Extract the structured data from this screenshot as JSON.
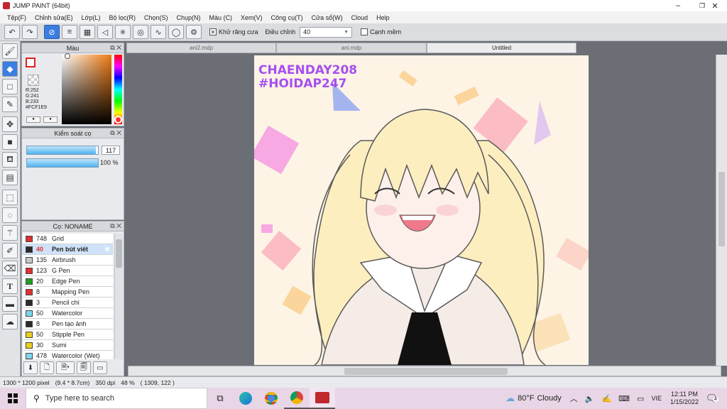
{
  "window": {
    "title": "JUMP PAINT (64bit)",
    "minimize": "–",
    "restore": "❐",
    "close": "✕"
  },
  "menu": [
    "Tệp(F)",
    "Chỉnh sửa(E)",
    "Lớp(L)",
    "Bộ lọc(R)",
    "Chọn(S)",
    "Chụp(N)",
    "Màu (C)",
    "Xem(V)",
    "Công cụ(T)",
    "Cửa sổ(W)",
    "Cloud",
    "Help"
  ],
  "toolbar": {
    "antialias_label": "Khử răng cưa",
    "correction_label": "Điều chỉnh",
    "correction_value": "40",
    "snap_label": "Cạnh mềm"
  },
  "color_panel": {
    "title": "Màu",
    "r": "R:252",
    "g": "G:241",
    "b": "B:233",
    "hex": "#FCF1E9"
  },
  "brush_control": {
    "title": "Kiểm soát cọ",
    "size_value": "117",
    "opacity_value": "100 %",
    "size_fraction": 0.97,
    "opacity_fraction": 1.0
  },
  "brush_panel": {
    "title": "Cọ: NONAME",
    "items": [
      {
        "size": "748",
        "name": "Grid",
        "color": "#e03030"
      },
      {
        "size": "40",
        "name": "Pen bút viết",
        "color": "#2a2a2a",
        "selected": true
      },
      {
        "size": "135",
        "name": "Airbrush",
        "color": "#c8c8c8"
      },
      {
        "size": "123",
        "name": "G Pen",
        "color": "#e03030"
      },
      {
        "size": "20",
        "name": "Edge Pen",
        "color": "#20a020"
      },
      {
        "size": "8",
        "name": "Mapping Pen",
        "color": "#e03030"
      },
      {
        "size": "3",
        "name": "Pencil chì",
        "color": "#2a2a2a"
      },
      {
        "size": "50",
        "name": "Watercolor",
        "color": "#7fd7f0"
      },
      {
        "size": "8",
        "name": "Pen tạo ảnh",
        "color": "#2a2a2a"
      },
      {
        "size": "50",
        "name": "Stipple Pen",
        "color": "#e8d020"
      },
      {
        "size": "30",
        "name": "Sumi",
        "color": "#e8d020"
      },
      {
        "size": "478",
        "name": "Watercolor (Wet)",
        "color": "#7fd7f0"
      }
    ]
  },
  "tabs": [
    "ani2.mdp",
    "ani.mdp",
    "Untitled"
  ],
  "canvas": {
    "text_line1": "CHAENDAY208",
    "text_line2": "#HOIDAP247",
    "bg_color": "#fdf4e6"
  },
  "status": {
    "dimensions": "1300 * 1200 pixel",
    "size_cm": "(9.4 * 8.7cm)",
    "dpi": "350 dpi",
    "zoom": "48 %",
    "coords": "( 1309, 122 )"
  },
  "taskbar": {
    "search_placeholder": "Type here to search",
    "weather_temp": "80°F",
    "weather_desc": "Cloudy",
    "lang": "VIE",
    "time": "12:11 PM",
    "date": "1/15/2022",
    "notification_count": "4"
  }
}
